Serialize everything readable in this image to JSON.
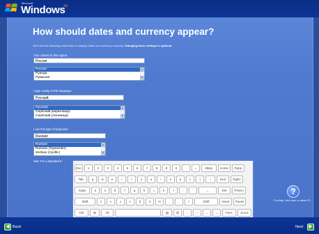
{
  "header": {
    "brand_small": "Microsoft",
    "brand": "Windows",
    "brand_xp": "xp"
  },
  "page": {
    "title": "How should dates and currency appear?",
    "intro": "We'll use the following information to display dates and currency correctly.",
    "intro_bold": "Changing these settings is optional."
  },
  "region": {
    "label": "I live closest to this region:",
    "value": "Россия",
    "options": [
      "Россия",
      "Руанда",
      "Румыния"
    ],
    "selected": 0
  },
  "language": {
    "label": "I type mostly in this language:",
    "value": "Русский",
    "options": [
      "Русский",
      "Сербский (кириллица)",
      "Сербский (латиница)"
    ],
    "selected": 0
  },
  "keyboard": {
    "label": "I use this type of keyboard:",
    "value": "Russian",
    "options": [
      "Russian",
      "Russian (Typewriter)",
      "Serbian (Cyrillic)"
    ],
    "selected": 0
  },
  "hint": "Hint: For a standard E",
  "onscreen_keyboard": {
    "rows": [
      [
        "Esc",
        "1",
        "2",
        "3",
        "4",
        "5",
        "6",
        "7",
        "8",
        "9",
        "0",
        "-",
        "=",
        "Bksp",
        "Home",
        "PgUp"
      ],
      [
        "Tab",
        "q",
        "w",
        "e",
        "r",
        "t",
        "y",
        "u",
        "i",
        "o",
        "p",
        "[",
        "]",
        "\\",
        "End",
        "PgDn"
      ],
      [
        "Caps",
        "a",
        "s",
        "d",
        "f",
        "g",
        "h",
        "j",
        "k",
        "l",
        ";",
        "'",
        "←",
        "Del",
        "PrtScn"
      ],
      [
        "Shift",
        "z",
        "x",
        "c",
        "v",
        "b",
        "n",
        "m",
        ",",
        ".",
        "/",
        "Shift",
        "Insert",
        "Pause"
      ],
      [
        "Ctrl",
        "⊞",
        "Alt",
        "",
        "▤",
        "@",
        "↓",
        "↑",
        "←",
        "→",
        "Func",
        "ScrLk"
      ]
    ]
  },
  "help": {
    "icon": "question-icon",
    "glyph": "?",
    "text": "For help, click here or press F1."
  },
  "footer": {
    "back_label": "Back",
    "next_label": "Next"
  }
}
